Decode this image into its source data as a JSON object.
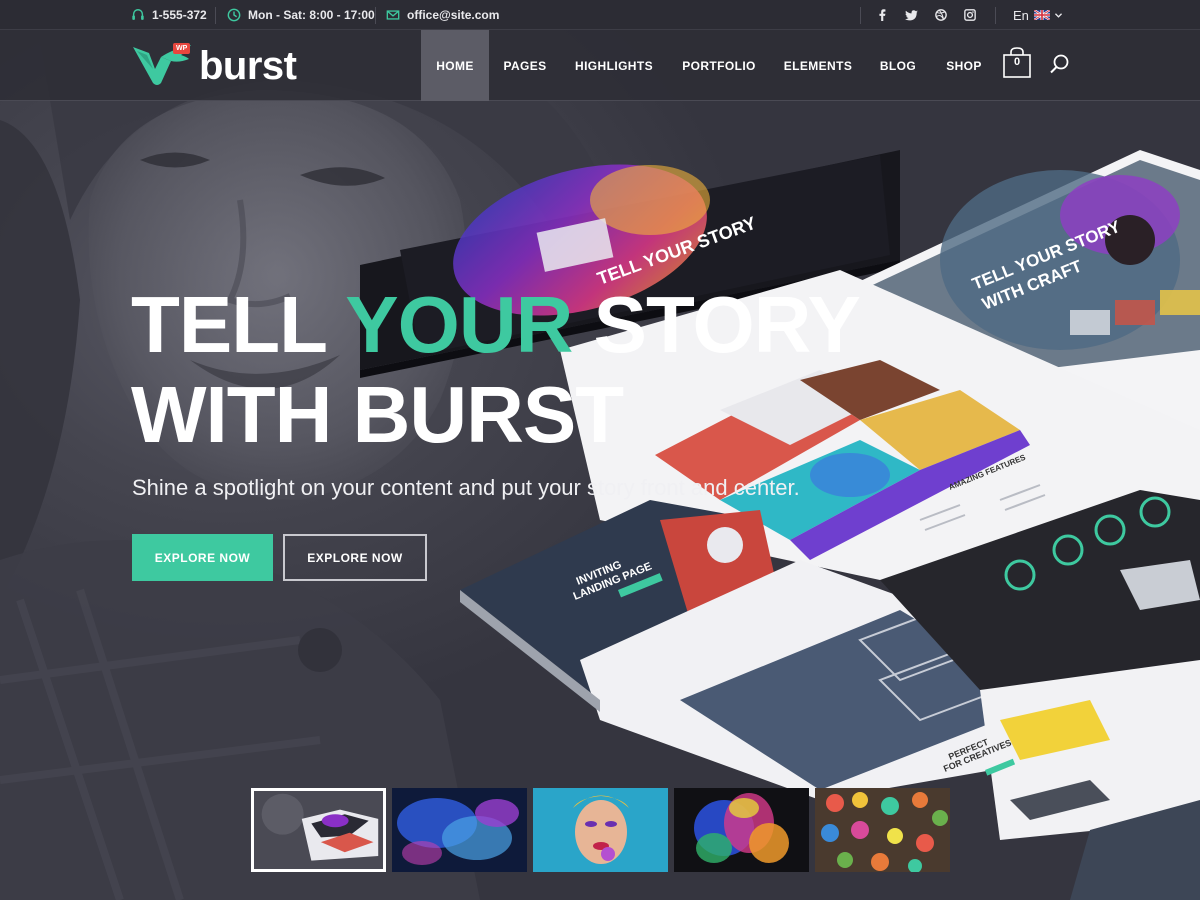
{
  "topbar": {
    "phone": "1-555-372",
    "hours": "Mon - Sat: 8:00 - 17:00",
    "email": "office@site.com",
    "language": "En",
    "social_icons": [
      "facebook-icon",
      "twitter-icon",
      "dribbble-icon",
      "instagram-icon"
    ]
  },
  "header": {
    "logo_text": "burst",
    "logo_badge": "WP",
    "nav": [
      "HOME",
      "PAGES",
      "HIGHLIGHTS",
      "PORTFOLIO",
      "ELEMENTS",
      "BLOG",
      "SHOP"
    ],
    "active_nav": "HOME",
    "cart_count": "0"
  },
  "hero": {
    "headline_part1": "TELL ",
    "headline_accent": "YOUR",
    "headline_part2": " STORY",
    "headline_line2": "WITH BURST",
    "subtitle": "Shine a spotlight on your content and put your story front and center.",
    "button_primary": "EXPLORE NOW",
    "button_secondary": "EXPLORE NOW"
  },
  "mockups": {
    "screen1_title": "TELL YOUR STORY",
    "screen2_title_line1": "TELL YOUR STORY",
    "screen2_title_line2": "WITH CRAFT",
    "screen3_title_line1": "INVITING",
    "screen3_title_line2": "LANDING PAGE",
    "screen4_heading": "AMAZING FEATURES",
    "screen5_heading_line1": "PERFECT",
    "screen5_heading_line2": "FOR CREATIVES"
  },
  "slider": {
    "thumbnails": [
      "thumb-mockups",
      "thumb-blue-smoke",
      "thumb-woman-makeup",
      "thumb-color-burst",
      "thumb-paper-balls"
    ],
    "active_index": 0
  },
  "colors": {
    "accent": "#3ec9a0",
    "topbar_bg": "#2c2c34",
    "header_bg": "#2d2d35",
    "badge": "#e8463d"
  }
}
